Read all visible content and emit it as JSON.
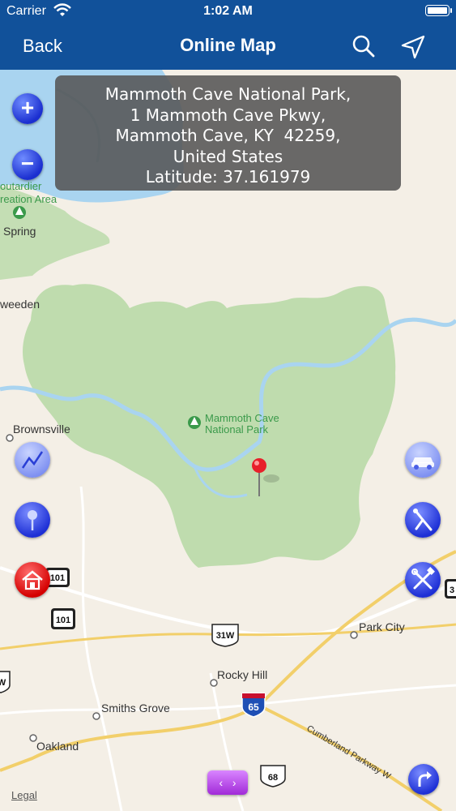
{
  "status_bar": {
    "carrier": "Carrier",
    "time": "1:02 AM"
  },
  "nav": {
    "back_label": "Back",
    "title": "Online Map",
    "search_icon": "search-icon",
    "locate_icon": "location-arrow-icon"
  },
  "info": {
    "lines": [
      "Mammoth Cave National Park,",
      "1 Mammoth Cave Pkwy,",
      "Mammoth Cave, KY  42259,",
      "United States",
      "Latitude: 37.161979"
    ]
  },
  "map_labels": {
    "boutardier": "outardier",
    "recreation": "reation Area",
    "spring": "Spring",
    "sweeden": "weeden",
    "brownsville": "Brownsville",
    "park_name_1": "Mammoth Cave",
    "park_name_2": "National Park",
    "park_city": "Park City",
    "rocky_hill": "Rocky Hill",
    "smiths_grove": "Smiths Grove",
    "oakland": "Oakland",
    "cumberland": "Cumberland Parkway W",
    "route_101_a": "101",
    "route_101_b": "101",
    "route_31w": "31W",
    "route_65": "65",
    "route_68": "68",
    "route_3": "3",
    "route_w": "W"
  },
  "controls": {
    "zoom_in": "+",
    "zoom_out": "−",
    "pager_left": "‹",
    "pager_right": "›",
    "legal": "Legal"
  },
  "colors": {
    "nav_bg": "#11519a",
    "park_green": "#bfdcae",
    "water": "#a9d4f0",
    "road_yellow": "#f2cf6a",
    "pin_red": "#e8202a"
  }
}
